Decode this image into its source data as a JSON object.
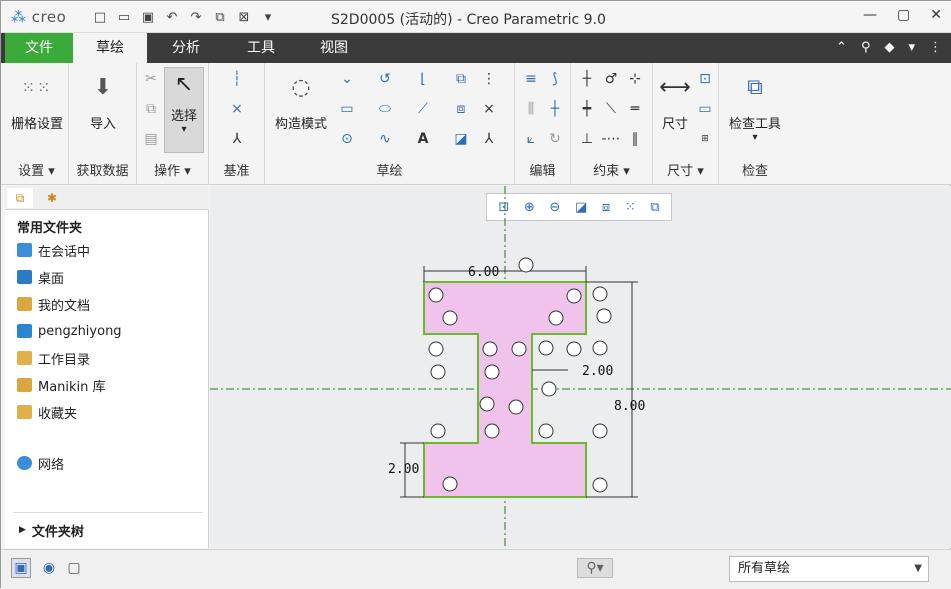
{
  "app": {
    "logo": "creo",
    "window_title": "S2D0005 (活动的) - Creo Parametric 9.0"
  },
  "tabs": [
    {
      "label": "文件"
    },
    {
      "label": "草绘"
    },
    {
      "label": "分析"
    },
    {
      "label": "工具"
    },
    {
      "label": "视图"
    }
  ],
  "ribbon": {
    "grid_settings": "栅格设置",
    "import": "导入",
    "select": "选择",
    "construct_mode": "构造模式",
    "dimension": "尺寸",
    "inspect_tool": "检查工具",
    "groups": {
      "settings": "设置",
      "get_data": "获取数据",
      "operations": "操作",
      "datum": "基准",
      "sketch": "草绘",
      "edit": "编辑",
      "constraints": "约束",
      "dimension": "尺寸",
      "inspect": "检查"
    }
  },
  "left_panel": {
    "heading": "常用文件夹",
    "items": [
      {
        "label": "在会话中",
        "color": "#3a8fd8"
      },
      {
        "label": "桌面",
        "color": "#2b7cc4"
      },
      {
        "label": "我的文档",
        "color": "#d9a640"
      },
      {
        "label": "pengzhiyong",
        "color": "#2b86d2"
      },
      {
        "label": "工作目录",
        "color": "#e0b04a"
      },
      {
        "label": "Manikin 库",
        "color": "#d9a640"
      },
      {
        "label": "收藏夹",
        "color": "#e0b04a"
      }
    ],
    "network": "网络",
    "folder_tree": "文件夹树"
  },
  "sketch": {
    "dim_top_width": "6.00",
    "dim_web": "2.00",
    "dim_height": "8.00",
    "dim_bottom_flange": "2.00",
    "fill_color": "#efc3ec",
    "outline_color": "#6aba2a"
  },
  "status_bar": {
    "filter_value": "所有草绘"
  }
}
